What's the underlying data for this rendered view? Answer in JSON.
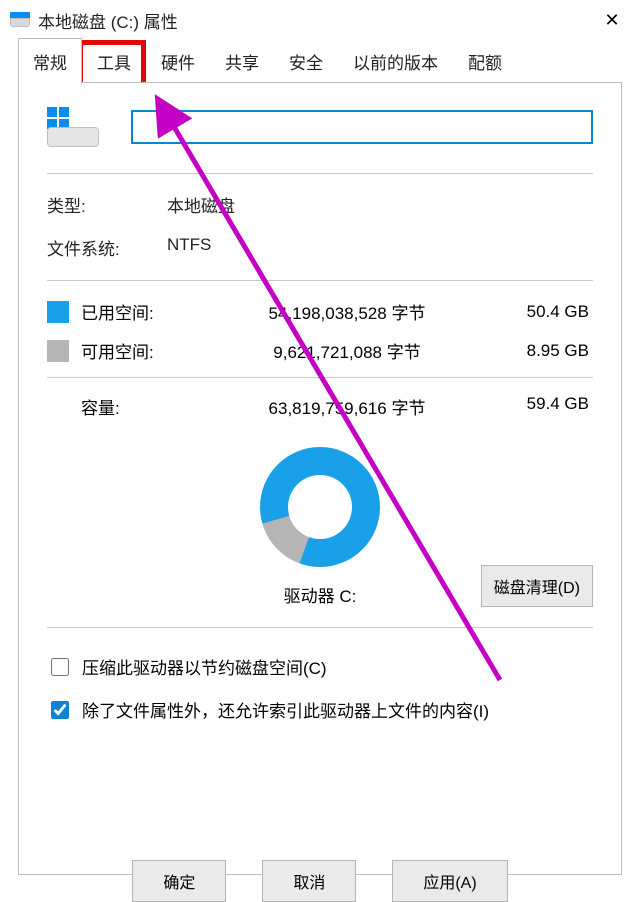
{
  "titlebar": {
    "title": "本地磁盘 (C:) 属性"
  },
  "tabs": {
    "general": "常规",
    "tools": "工具",
    "hardware": "硬件",
    "sharing": "共享",
    "security": "安全",
    "previous": "以前的版本",
    "quota": "配额"
  },
  "name_field": {
    "value": ""
  },
  "info": {
    "type_label": "类型:",
    "type_value": "本地磁盘",
    "fs_label": "文件系统:",
    "fs_value": "NTFS"
  },
  "usage": {
    "used_label": "已用空间:",
    "used_bytes": "54,198,038,528 字节",
    "used_gb": "50.4 GB",
    "free_label": "可用空间:",
    "free_bytes": "9,621,721,088 字节",
    "free_gb": "8.95 GB",
    "cap_label": "容量:",
    "cap_bytes": "63,819,759,616 字节",
    "cap_gb": "59.4 GB"
  },
  "drive_label": "驱动器 C:",
  "cleanup_button": "磁盘清理(D)",
  "checks": {
    "compress": "压缩此驱动器以节约磁盘空间(C)",
    "index": "除了文件属性外，还允许索引此驱动器上文件的内容(I)",
    "compress_checked": false,
    "index_checked": true
  },
  "buttons": {
    "ok": "确定",
    "cancel": "取消",
    "apply": "应用(A)"
  },
  "chart_data": {
    "type": "pie",
    "title": "驱动器 C:",
    "series": [
      {
        "name": "已用空间",
        "value": 50.4,
        "unit": "GB",
        "color": "#1aa0e8"
      },
      {
        "name": "可用空间",
        "value": 8.95,
        "unit": "GB",
        "color": "#b5b5b5"
      }
    ]
  }
}
